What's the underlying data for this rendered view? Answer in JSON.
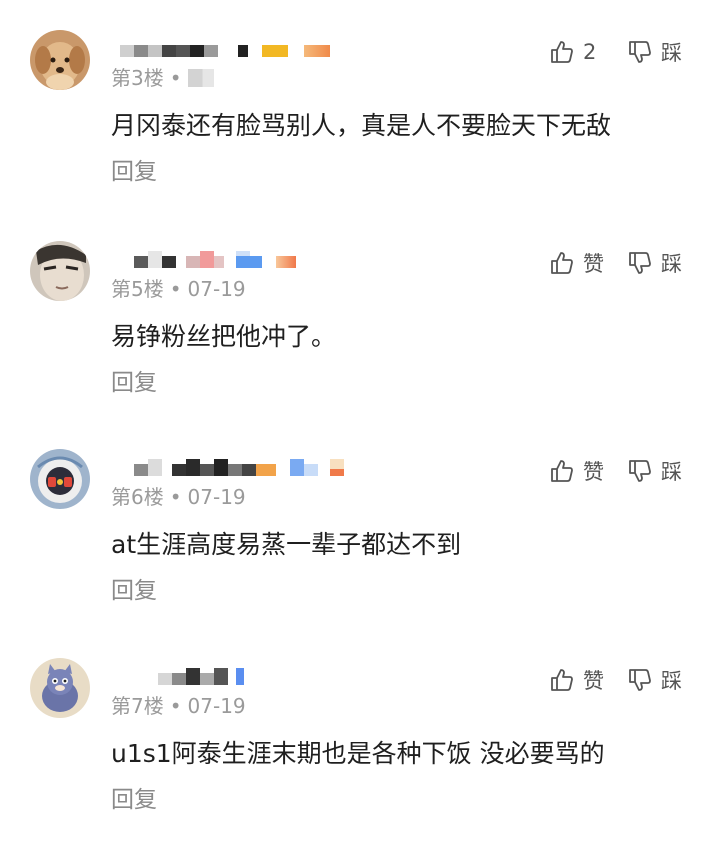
{
  "comments": [
    {
      "floor": "第3楼",
      "date": "",
      "text": "月冈泰还有脸骂别人，真是人不要脸天下无敌",
      "reply_label": "回复",
      "like_label": "2",
      "dislike_label": "踩",
      "avatar_icon": "dog-avatar"
    },
    {
      "floor": "第5楼",
      "date": "07-19",
      "text": "易铮粉丝把他冲了。",
      "reply_label": "回复",
      "like_label": "赞",
      "dislike_label": "踩",
      "avatar_icon": "face-avatar"
    },
    {
      "floor": "第6楼",
      "date": "07-19",
      "text": "at生涯高度易蒸一辈子都达不到",
      "reply_label": "回复",
      "like_label": "赞",
      "dislike_label": "踩",
      "avatar_icon": "astronaut-avatar"
    },
    {
      "floor": "第7楼",
      "date": "07-19",
      "text": "u1s1阿泰生涯末期也是各种下饭 没必要骂的",
      "reply_label": "回复",
      "like_label": "赞",
      "dislike_label": "踩",
      "avatar_icon": "cartoon-cat-avatar"
    }
  ],
  "separator_dot": "•"
}
